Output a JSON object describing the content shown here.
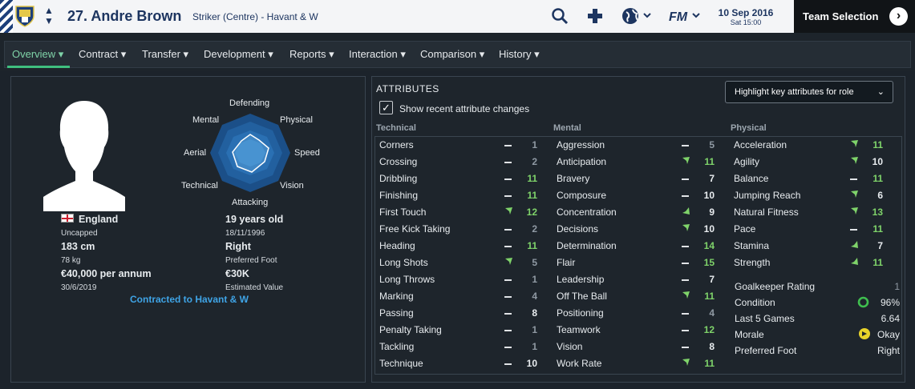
{
  "header": {
    "player_title": "27. Andre Brown",
    "role": "Striker (Centre) - Havant & W",
    "date": "10 Sep 2016",
    "time": "Sat 15:00",
    "team_selection": "Team Selection",
    "search_icon": "search-icon",
    "add_icon": "plus-icon",
    "world_icon": "globe-icon",
    "fm_logo": "FM"
  },
  "nav": {
    "tabs": [
      "Overview",
      "Contract",
      "Transfer",
      "Development",
      "Reports",
      "Interaction",
      "Comparison",
      "History"
    ]
  },
  "profile": {
    "nationality": "England",
    "caps": "Uncapped",
    "height": "183 cm",
    "weight": "78 kg",
    "wage": "€40,000 per annum",
    "contract_end": "30/6/2019",
    "age": "19 years old",
    "dob": "18/11/1996",
    "foot": "Right",
    "foot_label": "Preferred Foot",
    "value": "€30K",
    "value_label": "Estimated Value",
    "contracted": "Contracted to Havant & W"
  },
  "wheel": {
    "labels": {
      "defending": "Defending",
      "physical": "Physical",
      "speed": "Speed",
      "vision": "Vision",
      "attacking": "Attacking",
      "technical": "Technical",
      "aerial": "Aerial",
      "mental": "Mental"
    }
  },
  "attributes": {
    "title": "ATTRIBUTES",
    "show_changes": "Show recent attribute changes",
    "highlight": "Highlight key attributes for role",
    "technical_header": "Technical",
    "mental_header": "Mental",
    "physical_header": "Physical",
    "technical": [
      {
        "name": "Corners",
        "trend": "flat",
        "value": "1",
        "color": "gray"
      },
      {
        "name": "Crossing",
        "trend": "flat",
        "value": "2",
        "color": "gray"
      },
      {
        "name": "Dribbling",
        "trend": "flat",
        "value": "11",
        "color": "green"
      },
      {
        "name": "Finishing",
        "trend": "flat",
        "value": "11",
        "color": "green"
      },
      {
        "name": "First Touch",
        "trend": "up",
        "value": "12",
        "color": "green"
      },
      {
        "name": "Free Kick Taking",
        "trend": "flat",
        "value": "2",
        "color": "gray"
      },
      {
        "name": "Heading",
        "trend": "flat",
        "value": "11",
        "color": "green"
      },
      {
        "name": "Long Shots",
        "trend": "up",
        "value": "5",
        "color": "gray"
      },
      {
        "name": "Long Throws",
        "trend": "flat",
        "value": "1",
        "color": "gray"
      },
      {
        "name": "Marking",
        "trend": "flat",
        "value": "4",
        "color": "gray"
      },
      {
        "name": "Passing",
        "trend": "flat",
        "value": "8",
        "color": "white"
      },
      {
        "name": "Penalty Taking",
        "trend": "flat",
        "value": "1",
        "color": "gray"
      },
      {
        "name": "Tackling",
        "trend": "flat",
        "value": "1",
        "color": "gray"
      },
      {
        "name": "Technique",
        "trend": "flat",
        "value": "10",
        "color": "white"
      }
    ],
    "mental": [
      {
        "name": "Aggression",
        "trend": "flat",
        "value": "5",
        "color": "gray"
      },
      {
        "name": "Anticipation",
        "trend": "up",
        "value": "11",
        "color": "green"
      },
      {
        "name": "Bravery",
        "trend": "flat",
        "value": "7",
        "color": "white"
      },
      {
        "name": "Composure",
        "trend": "flat",
        "value": "10",
        "color": "white"
      },
      {
        "name": "Concentration",
        "trend": "up2",
        "value": "9",
        "color": "white"
      },
      {
        "name": "Decisions",
        "trend": "up",
        "value": "10",
        "color": "white"
      },
      {
        "name": "Determination",
        "trend": "flat",
        "value": "14",
        "color": "green"
      },
      {
        "name": "Flair",
        "trend": "flat",
        "value": "15",
        "color": "green"
      },
      {
        "name": "Leadership",
        "trend": "flat",
        "value": "7",
        "color": "white"
      },
      {
        "name": "Off The Ball",
        "trend": "up",
        "value": "11",
        "color": "green"
      },
      {
        "name": "Positioning",
        "trend": "flat",
        "value": "4",
        "color": "gray"
      },
      {
        "name": "Teamwork",
        "trend": "flat",
        "value": "12",
        "color": "green"
      },
      {
        "name": "Vision",
        "trend": "flat",
        "value": "8",
        "color": "white"
      },
      {
        "name": "Work Rate",
        "trend": "up",
        "value": "11",
        "color": "green"
      }
    ],
    "physical": [
      {
        "name": "Acceleration",
        "trend": "up",
        "value": "11",
        "color": "green"
      },
      {
        "name": "Agility",
        "trend": "up",
        "value": "10",
        "color": "white"
      },
      {
        "name": "Balance",
        "trend": "flat",
        "value": "11",
        "color": "green"
      },
      {
        "name": "Jumping Reach",
        "trend": "up",
        "value": "6",
        "color": "white"
      },
      {
        "name": "Natural Fitness",
        "trend": "up",
        "value": "13",
        "color": "green"
      },
      {
        "name": "Pace",
        "trend": "flat",
        "value": "11",
        "color": "green"
      },
      {
        "name": "Stamina",
        "trend": "up2",
        "value": "7",
        "color": "white"
      },
      {
        "name": "Strength",
        "trend": "up2",
        "value": "11",
        "color": "green"
      }
    ],
    "extra": [
      {
        "label": "Goalkeeper Rating",
        "value": "1"
      },
      {
        "label": "Condition",
        "value": "96%"
      },
      {
        "label": "Last 5 Games",
        "value": "6.64"
      },
      {
        "label": "Morale",
        "value": "Okay"
      },
      {
        "label": "Preferred Foot",
        "value": "Right"
      }
    ]
  }
}
